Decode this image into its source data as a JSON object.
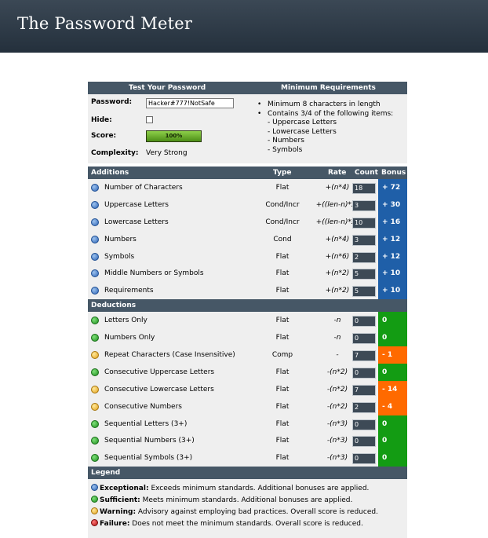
{
  "header": {
    "title": "The Password Meter"
  },
  "test": {
    "heading": "Test Your Password",
    "requirements_heading": "Minimum Requirements",
    "password_label": "Password:",
    "password_value": "Hacker#777!NotSafe",
    "hide_label": "Hide:",
    "score_label": "Score:",
    "score_value": "100%",
    "score_fraction": 1.0,
    "complexity_label": "Complexity:",
    "complexity_value": "Very Strong",
    "requirements": {
      "item1": "Minimum 8 characters in length",
      "item2": "Contains 3/4 of the following items:",
      "sub1": "- Uppercase Letters",
      "sub2": "- Lowercase Letters",
      "sub3": "- Numbers",
      "sub4": "- Symbols"
    }
  },
  "additions": {
    "heading": "Additions",
    "col_type": "Type",
    "col_rate": "Rate",
    "col_count": "Count",
    "col_bonus": "Bonus",
    "rows": [
      {
        "name": "Number of Characters",
        "type": "Flat",
        "rate": "+(n*4)",
        "count": "18",
        "bonus": "+ 72",
        "icon": "blue-info-icon"
      },
      {
        "name": "Uppercase Letters",
        "type": "Cond/Incr",
        "rate": "+((len-n)*2)",
        "count": "3",
        "bonus": "+ 30",
        "icon": "blue-info-icon"
      },
      {
        "name": "Lowercase Letters",
        "type": "Cond/Incr",
        "rate": "+((len-n)*2)",
        "count": "10",
        "bonus": "+ 16",
        "icon": "blue-info-icon"
      },
      {
        "name": "Numbers",
        "type": "Cond",
        "rate": "+(n*4)",
        "count": "3",
        "bonus": "+ 12",
        "icon": "blue-info-icon"
      },
      {
        "name": "Symbols",
        "type": "Flat",
        "rate": "+(n*6)",
        "count": "2",
        "bonus": "+ 12",
        "icon": "blue-info-icon"
      },
      {
        "name": "Middle Numbers or Symbols",
        "type": "Flat",
        "rate": "+(n*2)",
        "count": "5",
        "bonus": "+ 10",
        "icon": "blue-info-icon"
      },
      {
        "name": "Requirements",
        "type": "Flat",
        "rate": "+(n*2)",
        "count": "5",
        "bonus": "+ 10",
        "icon": "blue-info-icon"
      }
    ]
  },
  "deductions": {
    "heading": "Deductions",
    "rows": [
      {
        "name": "Letters Only",
        "type": "Flat",
        "rate": "-n",
        "count": "0",
        "bonus": "0",
        "status": "ok"
      },
      {
        "name": "Numbers Only",
        "type": "Flat",
        "rate": "-n",
        "count": "0",
        "bonus": "0",
        "status": "ok"
      },
      {
        "name": "Repeat Characters (Case Insensitive)",
        "type": "Comp",
        "rate": "-",
        "count": "7",
        "bonus": "- 1",
        "status": "warn"
      },
      {
        "name": "Consecutive Uppercase Letters",
        "type": "Flat",
        "rate": "-(n*2)",
        "count": "0",
        "bonus": "0",
        "status": "ok"
      },
      {
        "name": "Consecutive Lowercase Letters",
        "type": "Flat",
        "rate": "-(n*2)",
        "count": "7",
        "bonus": "- 14",
        "status": "warn"
      },
      {
        "name": "Consecutive Numbers",
        "type": "Flat",
        "rate": "-(n*2)",
        "count": "2",
        "bonus": "- 4",
        "status": "warn"
      },
      {
        "name": "Sequential Letters (3+)",
        "type": "Flat",
        "rate": "-(n*3)",
        "count": "0",
        "bonus": "0",
        "status": "ok"
      },
      {
        "name": "Sequential Numbers (3+)",
        "type": "Flat",
        "rate": "-(n*3)",
        "count": "0",
        "bonus": "0",
        "status": "ok"
      },
      {
        "name": "Sequential Symbols (3+)",
        "type": "Flat",
        "rate": "-(n*3)",
        "count": "0",
        "bonus": "0",
        "status": "ok"
      }
    ]
  },
  "legend": {
    "heading": "Legend",
    "exceptional_term": "Exceptional:",
    "exceptional_text": " Exceeds minimum standards. Additional bonuses are applied.",
    "sufficient_term": "Sufficient:",
    "sufficient_text": " Meets minimum standards. Additional bonuses are applied.",
    "warning_term": "Warning:",
    "warning_text": " Advisory against employing bad practices. Overall score is reduced.",
    "failure_term": "Failure:",
    "failure_text": " Does not meet the minimum standards. Overall score is reduced."
  },
  "colors": {
    "header_bg": "#2b3844",
    "section_head": "#465766",
    "bonus_blue": "#1f5fa8",
    "bonus_green": "#139c13",
    "bonus_orange": "#ff6a00"
  }
}
